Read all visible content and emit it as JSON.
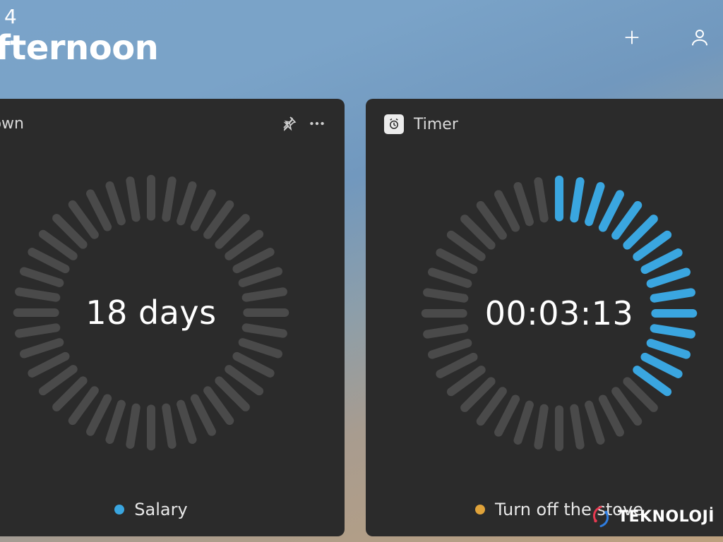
{
  "header": {
    "top_digit": "4",
    "greeting": "fternoon"
  },
  "colors": {
    "accent": "#3aa6e0",
    "tick_off": "#4a4a4a",
    "tick_on": "#3aa6e0",
    "legend_countdown": "#3aa6e0",
    "legend_timer": "#e0a33a"
  },
  "cards": {
    "countdown": {
      "title": "tdown",
      "value": "18 days",
      "legend": "Salary",
      "ticks_total": 40,
      "ticks_on": 0
    },
    "timer": {
      "title": "Timer",
      "value": "00:03:13",
      "legend": "Turn off the stove",
      "ticks_total": 40,
      "ticks_on": 15,
      "on_start_index": 0
    }
  },
  "watermark": {
    "text": "TEKNOLOJİ",
    "sub": ""
  }
}
